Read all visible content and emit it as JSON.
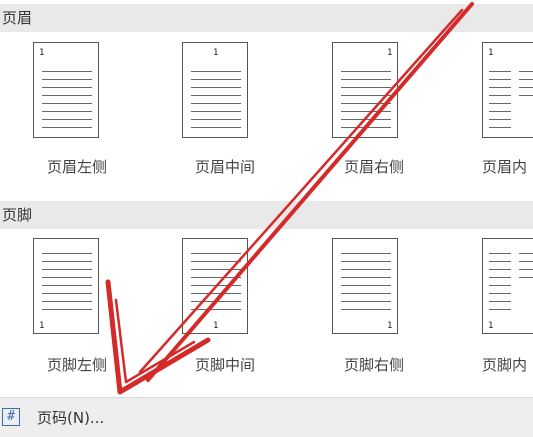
{
  "header_section": {
    "title": "页眉"
  },
  "footer_section": {
    "title": "页脚"
  },
  "header_items": [
    {
      "label": "页眉左侧",
      "num": "1"
    },
    {
      "label": "页眉中间",
      "num": "1"
    },
    {
      "label": "页眉右侧",
      "num": "1"
    },
    {
      "label": "页眉内",
      "num": "1"
    }
  ],
  "footer_items": [
    {
      "label": "页脚左侧",
      "num": "1"
    },
    {
      "label": "页脚中间",
      "num": "1"
    },
    {
      "label": "页脚右侧",
      "num": "1"
    },
    {
      "label": "页脚内",
      "num": "1"
    }
  ],
  "bottom_bar": {
    "label": "页码(N)...",
    "icon": "#"
  },
  "colors": {
    "annotation_arrow": "#d42a2a",
    "section_bg": "#e9e9e9"
  }
}
